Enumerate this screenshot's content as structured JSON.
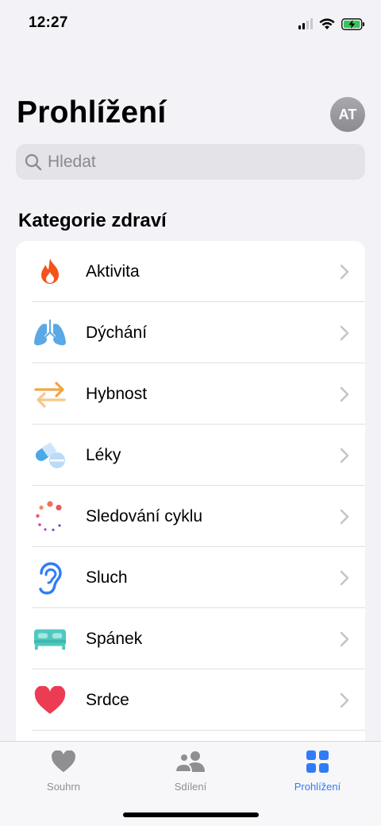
{
  "status_bar": {
    "time": "12:27",
    "icons": [
      "cellular-signal-icon",
      "wifi-icon",
      "battery-charging-icon"
    ]
  },
  "header": {
    "title": "Prohlížení",
    "avatar_initials": "AT"
  },
  "search": {
    "placeholder": "Hledat"
  },
  "section": {
    "title": "Kategorie zdraví"
  },
  "categories": [
    {
      "label": "Aktivita",
      "icon": "flame-icon",
      "color": "#f2541b"
    },
    {
      "label": "Dýchání",
      "icon": "lungs-icon",
      "color": "#5aa9e6"
    },
    {
      "label": "Hybnost",
      "icon": "arrows-icon",
      "color": "#f0a646"
    },
    {
      "label": "Léky",
      "icon": "pills-icon",
      "color": "#4aa8e8"
    },
    {
      "label": "Sledování cyklu",
      "icon": "cycle-icon",
      "color": "#e05a6e"
    },
    {
      "label": "Sluch",
      "icon": "ear-icon",
      "color": "#2f7cf6"
    },
    {
      "label": "Spánek",
      "icon": "bed-icon",
      "color": "#4fc9c0"
    },
    {
      "label": "Srdce",
      "icon": "heart-icon",
      "color": "#ee3b54"
    }
  ],
  "tab_bar": {
    "tabs": [
      {
        "label": "Souhrn",
        "icon": "heart-tab-icon",
        "active": false
      },
      {
        "label": "Sdílení",
        "icon": "people-icon",
        "active": false
      },
      {
        "label": "Prohlížení",
        "icon": "grid-icon",
        "active": true
      }
    ],
    "active_color": "#2f7cf6",
    "inactive_color": "#8e8e93"
  }
}
